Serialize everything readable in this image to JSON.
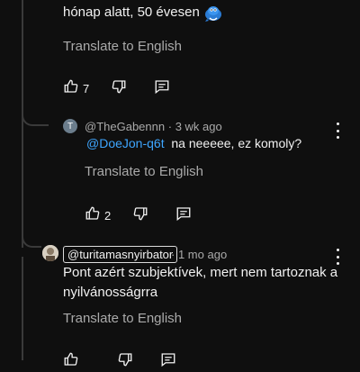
{
  "comment1": {
    "text_tail": "hónap alatt, 50 évesen",
    "translate_label": "Translate to English",
    "like_count": "7"
  },
  "reply1": {
    "avatar_letter": "T",
    "author": "@TheGabennn",
    "separator": "·",
    "time": "3 wk ago",
    "mention": "@DoeJon-q6t",
    "text": "na neeeee, ez komoly?",
    "translate_label": "Translate to English",
    "like_count": "2"
  },
  "comment2": {
    "author": "@turitamasnyirbator",
    "separator": "·",
    "time": "1 mo ago",
    "text_line1": "Pont azért szubjektívek, mert nem tartoznak a",
    "text_line2": "nyilvánosságrra",
    "translate_label": "Translate to English"
  },
  "colors": {
    "background": "#0f0f0f",
    "mention": "#3ea6ff",
    "secondary_text": "#aaaaaa"
  }
}
